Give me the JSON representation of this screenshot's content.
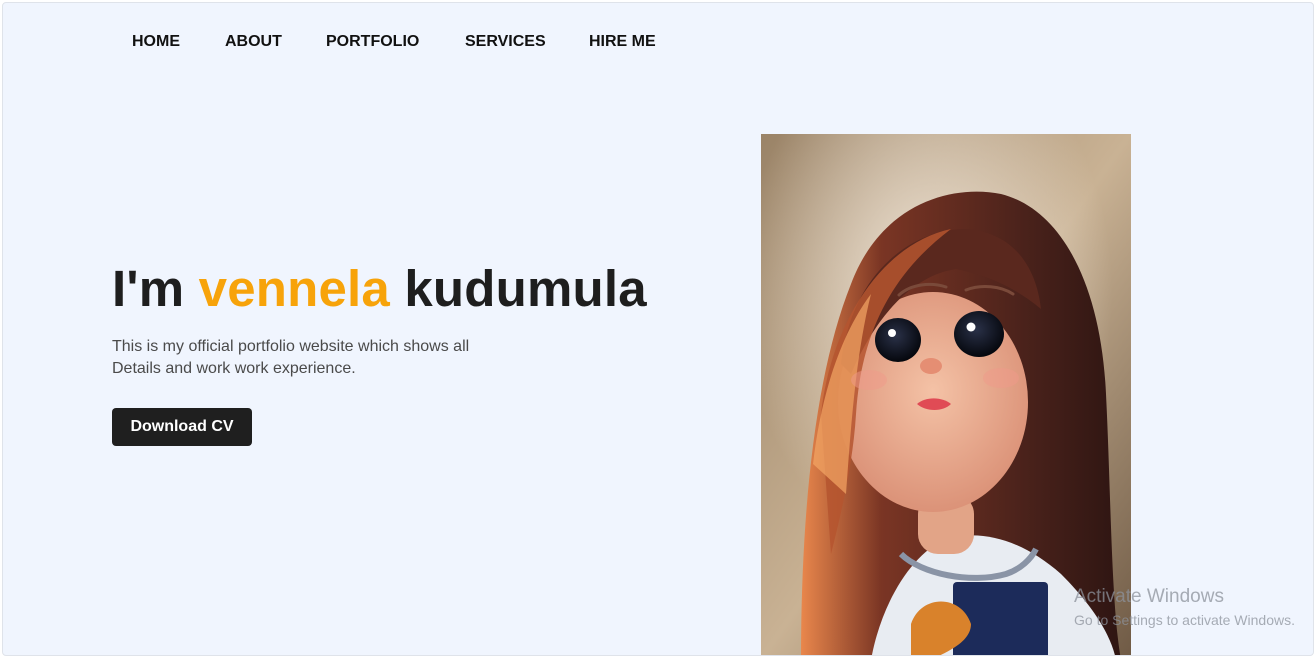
{
  "nav": {
    "items": [
      {
        "label": "HOME"
      },
      {
        "label": "ABOUT"
      },
      {
        "label": "PORTFOLIO"
      },
      {
        "label": "SERVICES"
      },
      {
        "label": "HIRE ME"
      }
    ]
  },
  "hero": {
    "title_prefix": "I'm ",
    "title_highlight": "vennela",
    "title_suffix": " kudumula",
    "description_line1": "This is my official portfolio website which shows all",
    "description_line2": "Details and work work experience.",
    "cta_label": "Download CV",
    "portrait_icon": "cartoon-girl-portrait"
  },
  "watermark": {
    "title": "Activate Windows",
    "subtitle": "Go to Settings to activate Windows."
  },
  "colors": {
    "background": "#f0f5fe",
    "accent": "#f7a30a",
    "button_bg": "#1f1f1f",
    "text_dark": "#1e1e1e"
  }
}
